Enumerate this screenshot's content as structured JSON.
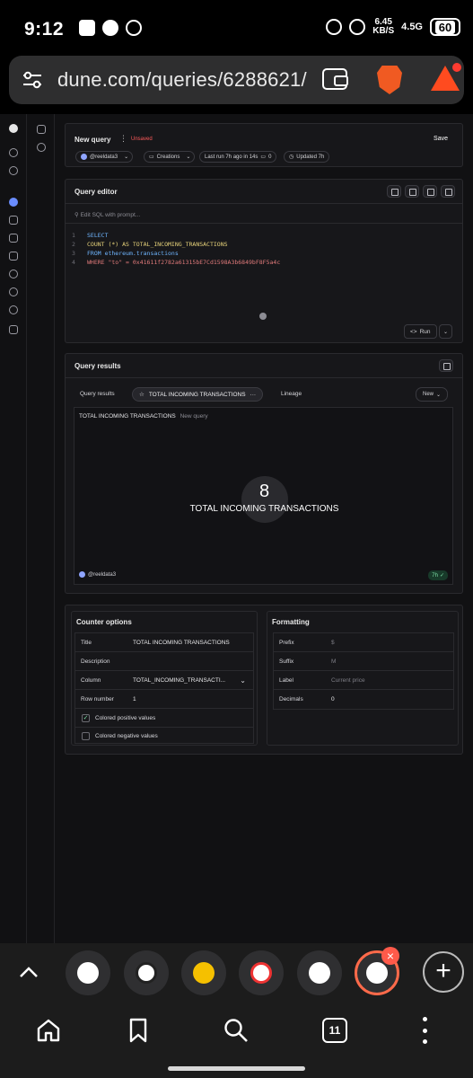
{
  "status_bar": {
    "time": "9:12",
    "net_speed": "6.45",
    "net_unit": "KB/S",
    "signal": "4.5G",
    "battery": "60"
  },
  "browser": {
    "url": "dune.com/queries/6288621/",
    "tab_count": "11"
  },
  "query_header": {
    "title": "New query",
    "unsaved_badge": "Unsaved",
    "save_label": "Save",
    "owner": "@reeldata3",
    "creations": "Creations",
    "last_run": "Last run 7h ago in 14s",
    "last_run_count": "0",
    "updated": "Updated 7h"
  },
  "editor": {
    "title": "Query editor",
    "prompt_placeholder": "Edit SQL with prompt...",
    "lines": [
      {
        "n": "1",
        "text": "SELECT"
      },
      {
        "n": "2",
        "text": "COUNT (*) AS TOTAL_INCOMING_TRANSACTIONS"
      },
      {
        "n": "3",
        "text": "FROM ethereum.transactions"
      },
      {
        "n": "4",
        "text": "WHERE \"to\" = 0x41611f2782a61315bE7Cd1598A3b6849bF8F5a4c"
      }
    ],
    "run_label": "Run"
  },
  "results": {
    "title": "Query results",
    "tabs": {
      "query_results": "Query results",
      "counter": "TOTAL INCOMING TRANSACTIONS",
      "lineage": "Lineage"
    },
    "new_label": "New",
    "viz_title": "TOTAL INCOMING TRANSACTIONS",
    "viz_subtitle": "New query",
    "counter_value": "8",
    "counter_label": "TOTAL INCOMING TRANSACTIONS",
    "footer_owner": "@reeldata3",
    "footer_age": "7h"
  },
  "counter_options": {
    "title": "Counter options",
    "rows": {
      "title_key": "Title",
      "title_val": "TOTAL INCOMING TRANSACTIONS",
      "description_key": "Description",
      "column_key": "Column",
      "column_val": "TOTAL_INCOMING_TRANSACTI...",
      "rownum_key": "Row number",
      "rownum_val": "1",
      "colored_positive": "Colored positive values",
      "colored_negative": "Colored negative values"
    }
  },
  "formatting": {
    "title": "Formatting",
    "prefix_key": "Prefix",
    "prefix_val": "$",
    "suffix_key": "Suffix",
    "suffix_val": "M",
    "label_key": "Label",
    "label_val": "Current price",
    "decimals_key": "Decimals",
    "decimals_val": "0"
  }
}
